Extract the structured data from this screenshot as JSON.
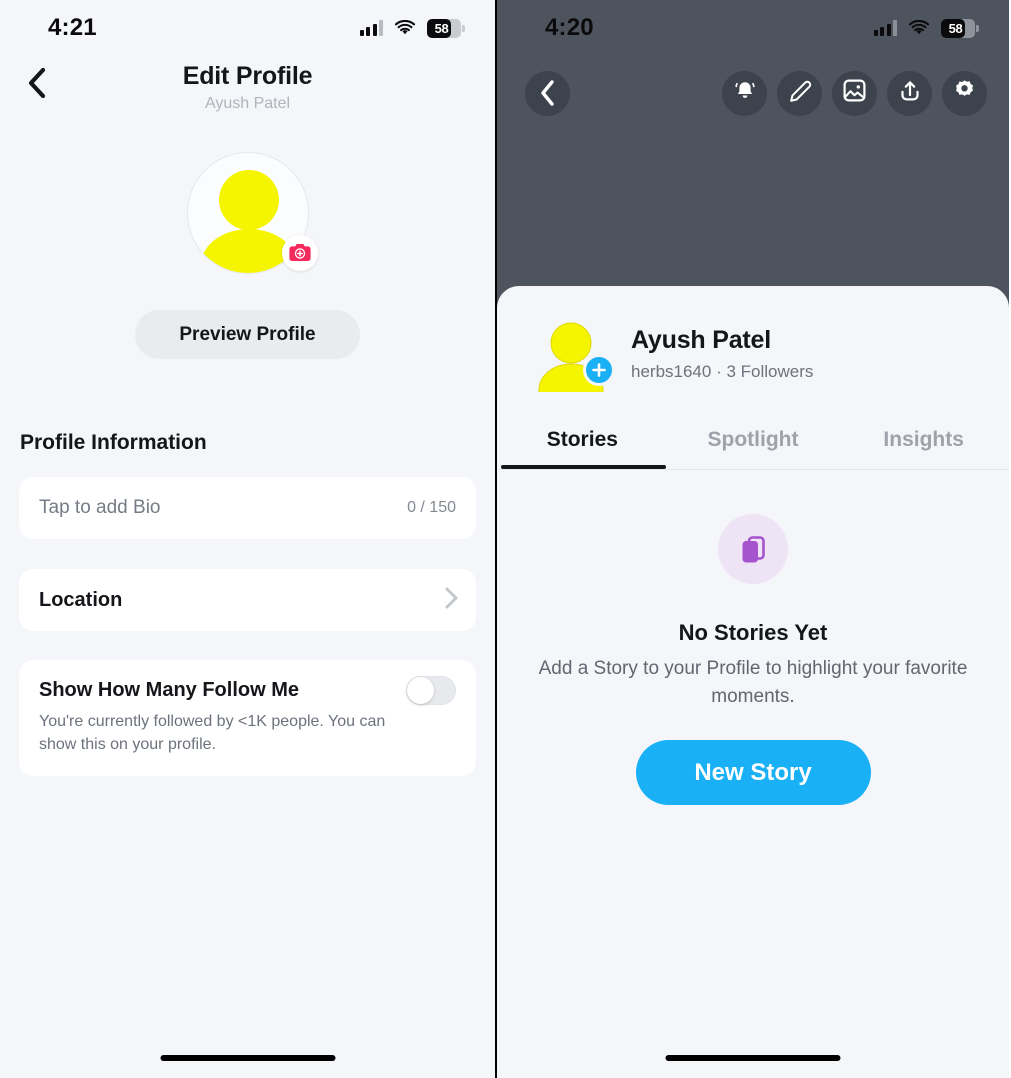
{
  "left_screen": {
    "status_bar": {
      "time": "4:21",
      "battery_level": "58",
      "signal_icon": "cellular-signal-icon",
      "wifi_icon": "wifi-icon",
      "battery_icon": "battery-icon"
    },
    "nav": {
      "back_icon": "back-chevron-icon",
      "title": "Edit Profile",
      "subtitle": "Ayush Patel"
    },
    "avatar": {
      "icon": "avatar-silhouette-icon",
      "badge_icon": "camera-plus-badge-icon",
      "badge_color": "#F4295C",
      "silhouette_color": "#F5F500"
    },
    "preview_button": {
      "label": "Preview Profile"
    },
    "section_title": "Profile Information",
    "bio_row": {
      "placeholder": "Tap to add Bio",
      "counter": "0 / 150"
    },
    "location_row": {
      "label": "Location",
      "chevron_icon": "chevron-right-icon"
    },
    "follow_toggle_row": {
      "title": "Show How Many Follow Me",
      "description": "You're currently followed by <1K people. You can show this on your profile.",
      "toggle_state": "off"
    },
    "home_indicator": "home-indicator"
  },
  "right_screen": {
    "status_bar": {
      "time": "4:20",
      "battery_level": "58",
      "signal_icon": "cellular-signal-icon",
      "wifi_icon": "wifi-icon",
      "battery_icon": "battery-icon"
    },
    "toolbar": {
      "back_icon": "back-chevron-icon",
      "buttons": [
        {
          "name": "notifications-button",
          "icon": "bell-icon"
        },
        {
          "name": "edit-profile-button",
          "icon": "pencil-icon"
        },
        {
          "name": "photo-button",
          "icon": "image-icon"
        },
        {
          "name": "share-button",
          "icon": "share-upload-icon"
        },
        {
          "name": "settings-button",
          "icon": "gear-icon"
        }
      ]
    },
    "profile": {
      "avatar_icon": "avatar-silhouette-icon",
      "add_badge_icon": "plus-badge-icon",
      "accent_color": "#19B0F5",
      "name": "Ayush Patel",
      "meta": "herbs1640 · 3 Followers"
    },
    "tabs": [
      {
        "label": "Stories",
        "active": true
      },
      {
        "label": "Spotlight",
        "active": false
      },
      {
        "label": "Insights",
        "active": false
      }
    ],
    "empty_state": {
      "icon": "stacked-cards-icon",
      "icon_color": "#A653CE",
      "title": "No Stories Yet",
      "description": "Add a Story to your Profile to highlight your favorite moments.",
      "button_label": "New Story"
    },
    "home_indicator": "home-indicator"
  }
}
